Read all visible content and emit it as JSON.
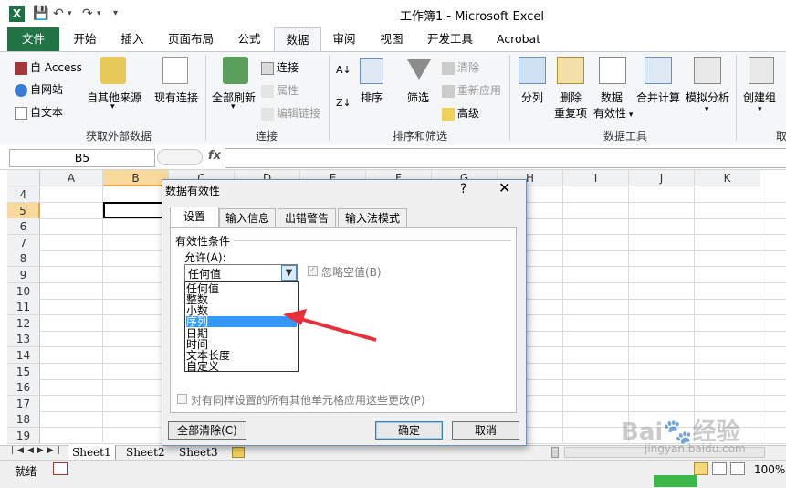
{
  "window": {
    "app_icon": "X",
    "title": "工作簿1 - Microsoft Excel"
  },
  "tabs": [
    {
      "label": "文件"
    },
    {
      "label": "开始"
    },
    {
      "label": "插入"
    },
    {
      "label": "页面布局"
    },
    {
      "label": "公式"
    },
    {
      "label": "数据"
    },
    {
      "label": "审阅"
    },
    {
      "label": "视图"
    },
    {
      "label": "开发工具"
    },
    {
      "label": "Acrobat"
    }
  ],
  "ribbon": {
    "external": {
      "access": "自 Access",
      "web": "自网站",
      "text": "自文本",
      "other": "自其他来源",
      "existing": "现有连接",
      "group": "获取外部数据"
    },
    "connections": {
      "refresh": "全部刷新",
      "connections": "连接",
      "properties": "属性",
      "edit_links": "编辑链接",
      "group": "连接"
    },
    "sort_filter": {
      "sort": "排序",
      "filter": "筛选",
      "clear": "清除",
      "reapply": "重新应用",
      "advanced": "高级",
      "group": "排序和筛选"
    },
    "data_tools": {
      "split": "分列",
      "remove_dup_1": "删除",
      "remove_dup_2": "重复项",
      "validation_1": "数据",
      "validation_2": "有效性",
      "consolidate": "合并计算",
      "what_if": "模拟分析",
      "group": "数据工具"
    },
    "outline": {
      "group_btn": "创建组",
      "cut_label": "取"
    }
  },
  "formula_bar": {
    "name_box": "B5",
    "fx": "fx"
  },
  "columns": [
    "A",
    "B",
    "C",
    "D",
    "E",
    "F",
    "G",
    "H",
    "I",
    "J",
    "K"
  ],
  "rows": [
    "4",
    "5",
    "6",
    "7",
    "8",
    "9",
    "10",
    "11",
    "12",
    "13",
    "14",
    "15",
    "16",
    "17",
    "18",
    "19"
  ],
  "sheets": [
    "Sheet1",
    "Sheet2",
    "Sheet3"
  ],
  "status": {
    "ready": "就绪",
    "zoom": "100%"
  },
  "dialog": {
    "title": "数据有效性",
    "help": "?",
    "tabs": [
      "设置",
      "输入信息",
      "出错警告",
      "输入法模式"
    ],
    "section": "有效性条件",
    "allow_label": "允许(A):",
    "allow_value": "任何值",
    "ignore_blank": "忽略空值(B)",
    "options": [
      "任何值",
      "整数",
      "小数",
      "序列",
      "日期",
      "时间",
      "文本长度",
      "自定义"
    ],
    "highlighted_index": 3,
    "apply_all": "对有同样设置的所有其他单元格应用这些更改(P)",
    "clear_all": "全部清除(C)",
    "ok": "确定",
    "cancel": "取消"
  },
  "watermark": {
    "text1": "Bai",
    "text2": "经验",
    "url": "jingyan.baidu.com"
  },
  "colors": {
    "excel_green": "#227446",
    "highlight": "#3399ff",
    "arrow": "#e8303a"
  }
}
